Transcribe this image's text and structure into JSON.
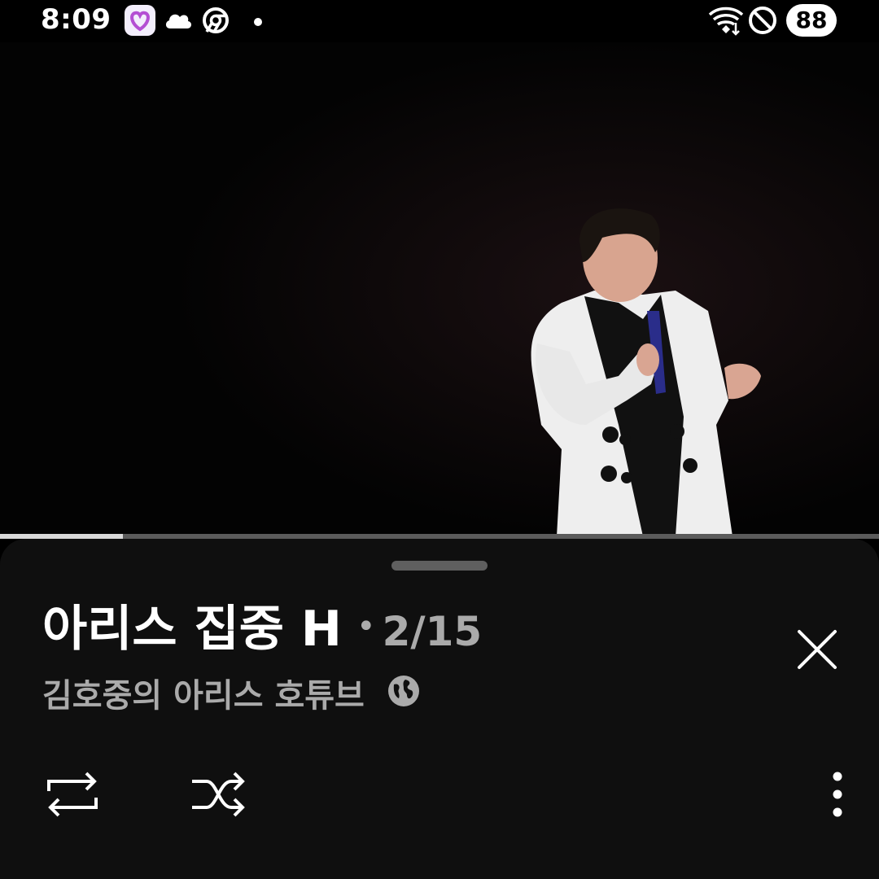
{
  "status_bar": {
    "time": "8:09",
    "battery": "88",
    "left_icons": [
      "app-heart-icon",
      "cloud-icon",
      "chrome-icon",
      "notification-dot-icon"
    ],
    "right_icons": [
      "wifi-icon",
      "do-not-disturb-icon"
    ]
  },
  "player": {
    "progress_fraction": 0.14
  },
  "playlist": {
    "title": "아리스 집중 H",
    "separator": "•",
    "position": "2/15",
    "channel": "김호중의 아리스 호튜브",
    "visibility_icon": "globe-icon",
    "close_icon": "close-icon",
    "controls": {
      "loop_icon": "loop-icon",
      "shuffle_icon": "shuffle-icon",
      "more_icon": "more-vert-icon"
    }
  },
  "colors": {
    "sheet_background": "#0f0f0f",
    "secondary_text": "#aaaaaa",
    "progress_fill": "#d9d9d9",
    "progress_track": "#5b5b5b"
  }
}
